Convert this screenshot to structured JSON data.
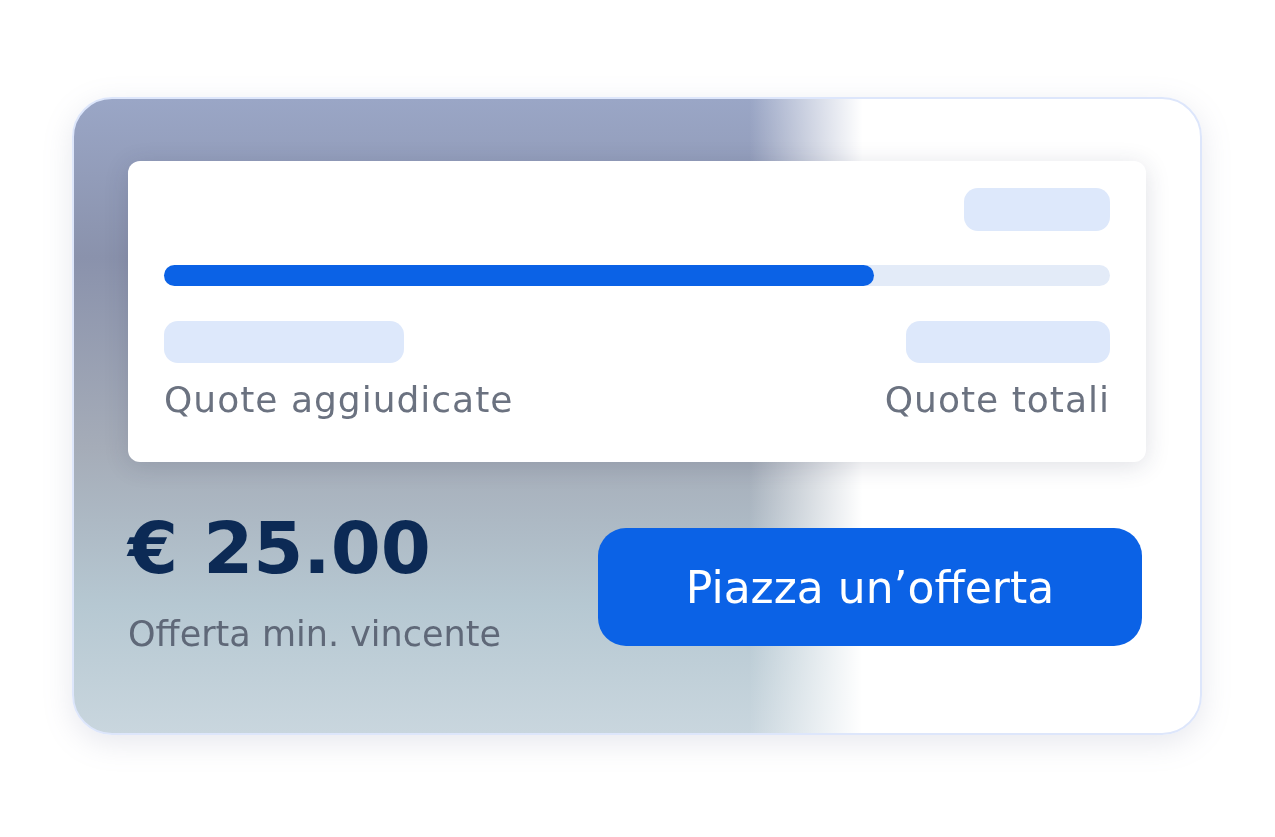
{
  "progress": {
    "level": 0.75,
    "left_label": "Quote aggiudicate",
    "right_label": "Quote totali"
  },
  "price": "€ 25.00",
  "price_caption": "Offerta min. vincente",
  "button": {
    "label": "Piazza un’offerta"
  }
}
